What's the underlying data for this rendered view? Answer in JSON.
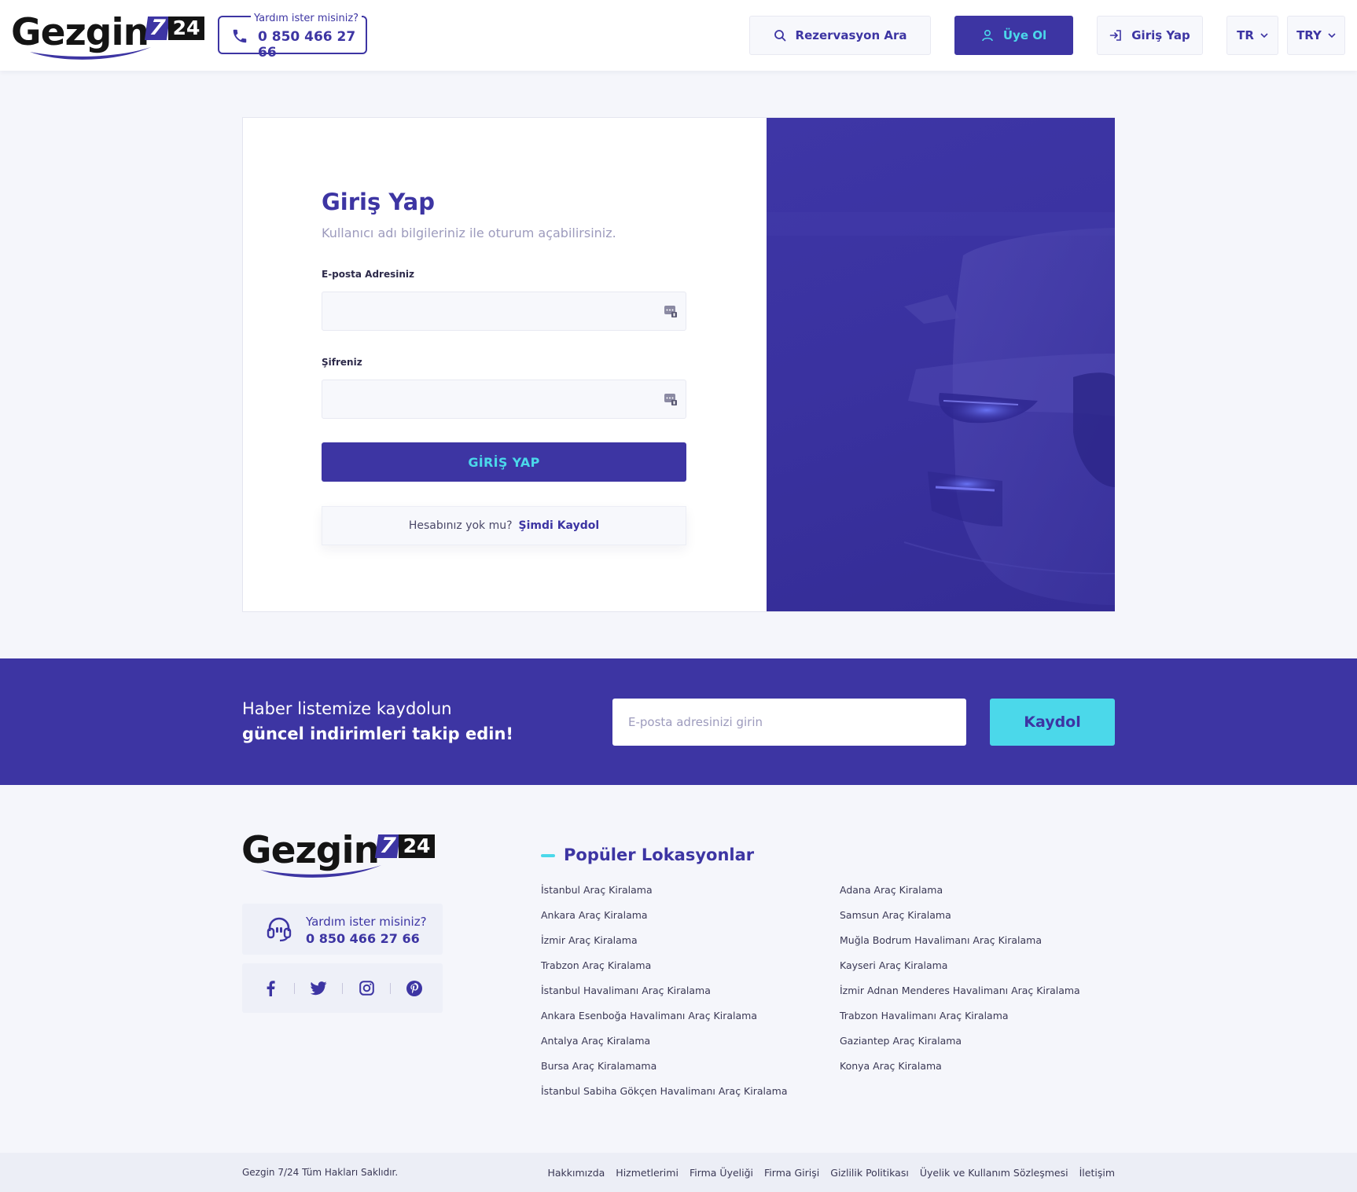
{
  "brand": {
    "name": "Gezgin",
    "num7": "7",
    "num24": "24",
    "color_primary": "#3d35a3",
    "color_accent": "#4bd8ea"
  },
  "header": {
    "help_label": "Yardım ister misiniz?",
    "help_phone": "0 850 466 27 66",
    "search_label": "Rezervasyon Ara",
    "signup_label": "Üye Ol",
    "login_label": "Giriş Yap",
    "language": "TR",
    "currency": "TRY"
  },
  "login": {
    "title": "Giriş Yap",
    "subtitle": "Kullanıcı adı bilgileriniz ile oturum açabilirsiniz.",
    "email_label": "E-posta Adresiniz",
    "email_value": "",
    "password_label": "Şifreniz",
    "password_value": "",
    "submit_label": "GİRİŞ YAP",
    "no_account_text": "Hesabınız yok mu?",
    "register_link": "Şimdi Kaydol"
  },
  "newsletter": {
    "line1": "Haber listemize kaydolun",
    "line2": "güncel indirimleri takip edin!",
    "placeholder": "E-posta adresinizi girin",
    "button_label": "Kaydol"
  },
  "footer": {
    "help_label": "Yardım ister misiniz?",
    "help_phone": "0 850 466 27 66",
    "social": [
      "facebook-icon",
      "twitter-icon",
      "instagram-icon",
      "pinterest-icon"
    ],
    "locations_title": "Popüler Lokasyonlar",
    "locations_col1": [
      "İstanbul Araç Kiralama",
      "Ankara Araç Kiralama",
      "İzmir Araç Kiralama",
      "Trabzon Araç Kiralama",
      "İstanbul Havalimanı Araç Kiralama",
      "Ankara Esenboğa Havalimanı Araç Kiralama",
      "Antalya Araç Kiralama",
      "Bursa Araç Kiralamama",
      "İstanbul Sabiha Gökçen Havalimanı Araç Kiralama"
    ],
    "locations_col2": [
      "Adana Araç Kiralama",
      "Samsun Araç Kiralama",
      "Muğla Bodrum Havalimanı Araç Kiralama",
      "Kayseri Araç Kiralama",
      "İzmir Adnan Menderes Havalimanı Araç Kiralama",
      "Trabzon Havalimanı Araç Kiralama",
      "Gaziantep Araç Kiralama",
      "Konya Araç Kiralama"
    ],
    "copyright": "Gezgin 7/24 Tüm Hakları Saklıdır.",
    "bottom_links": [
      "Hakkımızda",
      "Hizmetlerimi",
      "Firma Üyeliği",
      "Firma Girişi",
      "Gizlilik Politikası",
      "Üyelik ve Kullanım Sözleşmesi",
      "İletişim"
    ]
  }
}
